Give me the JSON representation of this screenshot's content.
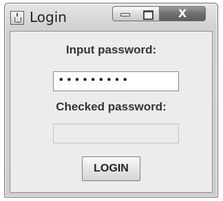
{
  "window": {
    "title": "Login",
    "app_icon": "java-cup-icon",
    "controls": {
      "minimize_icon": "minimize-icon",
      "maximize_icon": "maximize-icon",
      "close_icon": "close-icon",
      "close_glyph": "X"
    }
  },
  "form": {
    "password_label": "Input password:",
    "password_value": "•••••••••",
    "checked_label": "Checked password:",
    "checked_value": "",
    "login_label": "LOGIN"
  },
  "colors": {
    "window_bg": "#d2d2d2",
    "content_bg": "#ececec",
    "close_button": "#6f6f6f"
  }
}
